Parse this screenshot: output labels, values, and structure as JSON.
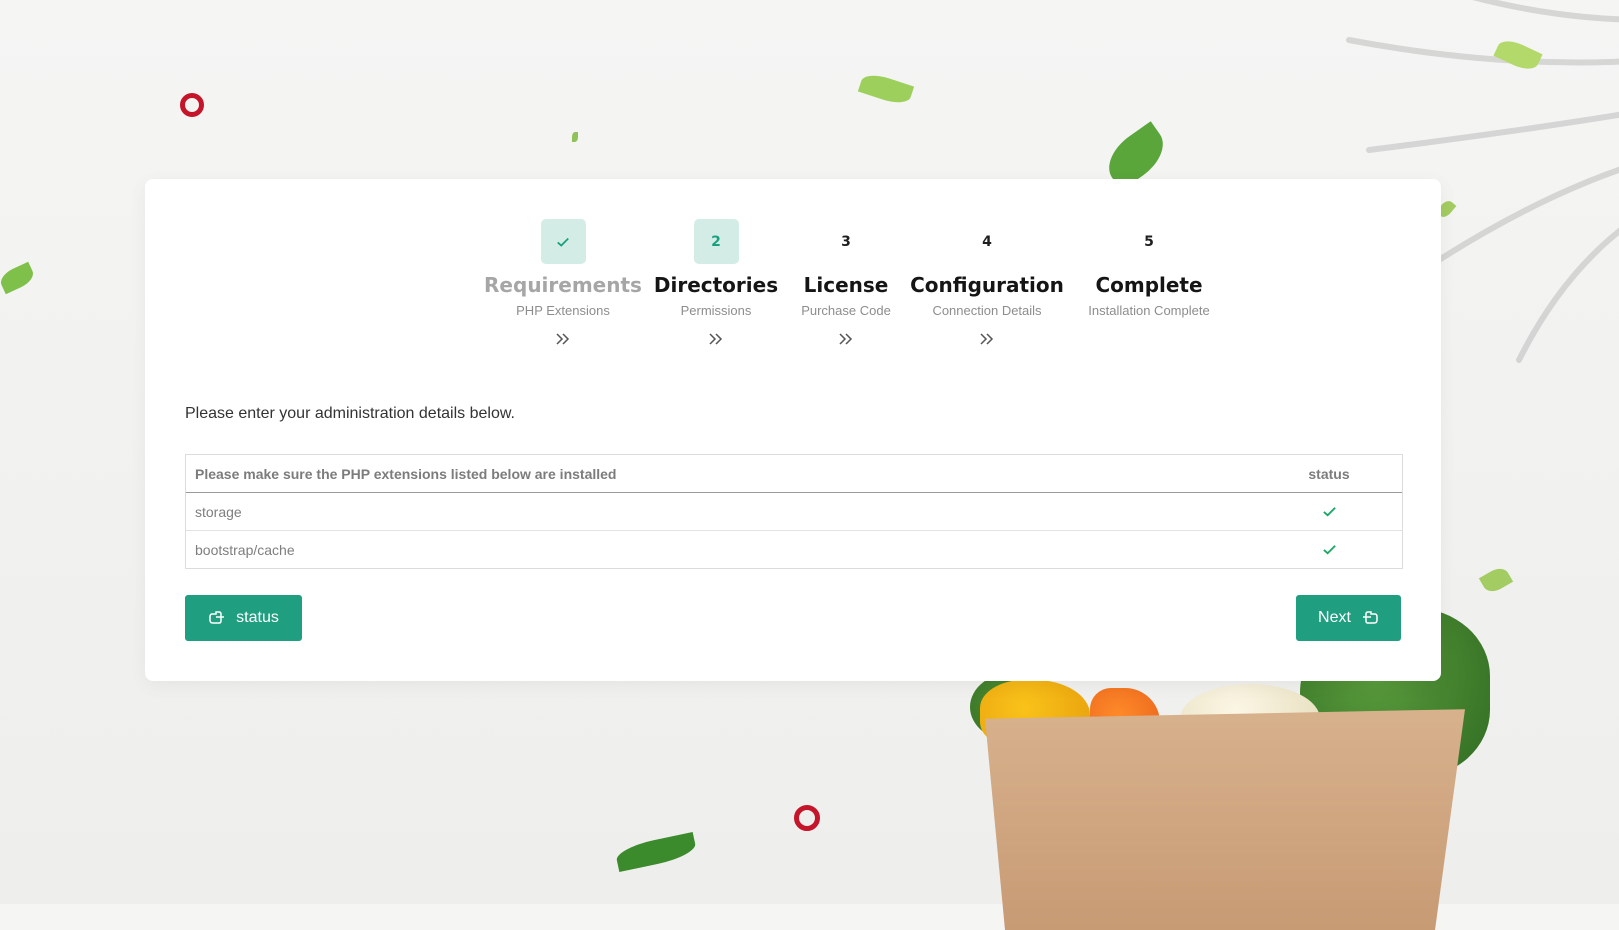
{
  "steps": [
    {
      "number": "✓",
      "title": "Requirements",
      "subtitle": "PHP Extensions",
      "state": "done"
    },
    {
      "number": "2",
      "title": "Directories",
      "subtitle": "Permissions",
      "state": "active"
    },
    {
      "number": "3",
      "title": "License",
      "subtitle": "Purchase Code",
      "state": "pending"
    },
    {
      "number": "4",
      "title": "Configuration",
      "subtitle": "Connection Details",
      "state": "pending"
    },
    {
      "number": "5",
      "title": "Complete",
      "subtitle": "Installation Complete",
      "state": "pending"
    }
  ],
  "intro": "Please enter your administration details below.",
  "table": {
    "header": {
      "label": "Please make sure the PHP extensions listed below are installed",
      "status": "status"
    },
    "rows": [
      {
        "name": "storage",
        "status_icon": "check-icon"
      },
      {
        "name": "bootstrap/cache",
        "status_icon": "check-icon"
      }
    ]
  },
  "buttons": {
    "status_label": "status",
    "next_label": "Next"
  },
  "colors": {
    "accent": "#1f9f80",
    "accent_light": "#d3ece5",
    "check": "#1aa864"
  }
}
